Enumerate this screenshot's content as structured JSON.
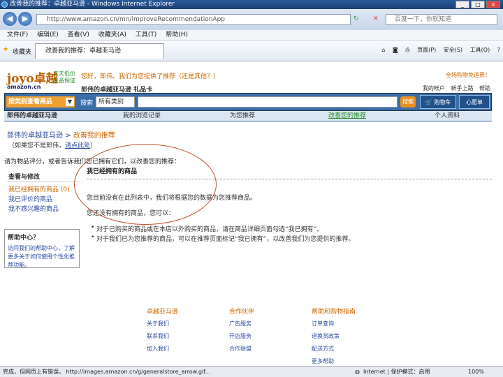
{
  "window": {
    "title": "改善我的推荐：卓越亚马逊 - Windows Internet Explorer"
  },
  "browser": {
    "url": "http://www.amazon.cn/mn/improveRecommendationApp",
    "search_placeholder": "百度一下，你就知道",
    "menu": [
      "文件(F)",
      "编辑(E)",
      "查看(V)",
      "收藏夹(A)",
      "工具(T)",
      "帮助(H)"
    ],
    "favorites_label": "收藏夹",
    "tab_title": "改善我的推荐：卓越亚马逊",
    "tools": [
      "页面(P)",
      "安全(S)",
      "工具(O)"
    ]
  },
  "site": {
    "logo": "joyo卓越",
    "logo_sub": "amazon.cn",
    "slogan_line1": "天天低价",
    "slogan_line2": "正品保证",
    "greeting": "您好，郎伟。我们为您提供了推荐（还是其他？）",
    "sub_greeting": "郎伟的卓越亚马逊  礼品卡",
    "top_right": "全场购物免运费！",
    "account_links": [
      "我的帐户",
      "新手上路",
      "帮助"
    ],
    "category_label": "按类别查看商品",
    "search_label": "搜索",
    "search_category": "所有类别",
    "search_go": "搜索",
    "cart": "购物车",
    "wishlist": "心愿单",
    "subnav": [
      "郎伟的卓越亚马逊",
      "我的浏览记录",
      "为您推荐",
      "改善您的推荐",
      "个人资料"
    ]
  },
  "content": {
    "breadcrumb_link": "郎伟的卓越亚马逊",
    "breadcrumb_current": "改善我的推荐",
    "hint_text": "（如果您不是郎伟，",
    "hint_link": "请点此处",
    "hint_end": "）",
    "note": "请为物品评分，或者告诉我们您已拥有它们，以改善您的推荐：",
    "left_heading": "查看与修改",
    "left_items": [
      "我已经拥有的商品 (0)",
      "我已评价的商品",
      "我不感兴趣的商品"
    ],
    "help_title": "帮助中心？",
    "help_text": "访问我们的帮助中心，了解更多关于如何使用个性化推荐功能。",
    "main_heading": "我已经拥有的商品",
    "line1": "您目前没有在此列表中，我们将根据您的数据为您推荐商品。",
    "line2": "您还没有拥有的商品，您可以：",
    "bullet1": "对于已购买的商品或在本店以外购买的商品，请在商品详细页面勾选“我已拥有”。",
    "bullet2": "对于我们已为您推荐的商品，可以在推荐页面标记“我已拥有”，以改善我们为您提供的推荐。"
  },
  "footer": {
    "col1": {
      "title": "卓越亚马逊",
      "links": [
        "关于我们",
        "联系我们",
        "加入我们"
      ]
    },
    "col2": {
      "title": "合作伙伴",
      "links": [
        "广告服务",
        "开店服务",
        "合作联盟"
      ]
    },
    "col3": {
      "title": "帮助和购物指南",
      "links": [
        "订单查询",
        "退换货政策",
        "配送方式",
        "更多帮助"
      ]
    }
  },
  "status": {
    "text": "完成，但网页上有错误。 http://images.amazon.cn/g/generalstore_arrow.gif...",
    "zone": "Internet | 保护模式：启用",
    "zoom": "100%"
  }
}
